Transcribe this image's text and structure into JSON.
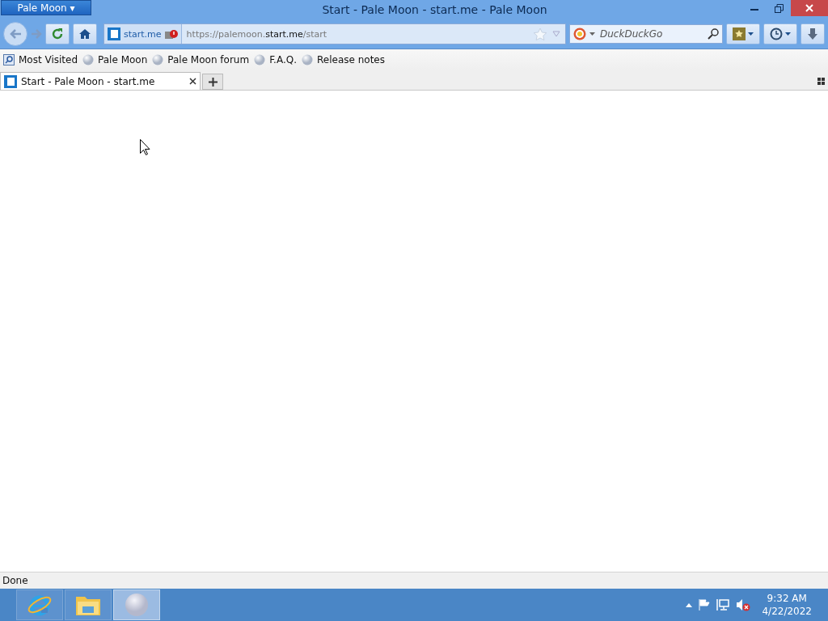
{
  "window": {
    "title": "Start - Pale Moon - start.me - Pale Moon",
    "app_menu": "Pale Moon ▾"
  },
  "toolbar": {
    "identity": "start.me",
    "url": "https://palemoon.**start.me**/start",
    "search_placeholder": "DuckDuckGo"
  },
  "bookmarks": [
    {
      "label": "Most Visited",
      "kind": "folder"
    },
    {
      "label": "Pale Moon",
      "kind": "page"
    },
    {
      "label": "Pale Moon forum",
      "kind": "page"
    },
    {
      "label": "F.A.Q.",
      "kind": "page"
    },
    {
      "label": "Release notes",
      "kind": "page"
    }
  ],
  "tabs": [
    {
      "label": "Start - Pale Moon - start.me",
      "selected": true
    }
  ],
  "status_bar": "Done",
  "taskbar": {
    "items": [
      {
        "kind": "ie",
        "selected": false
      },
      {
        "kind": "explorer",
        "selected": false
      },
      {
        "kind": "palemoon",
        "selected": true
      }
    ],
    "time": "9:32 AM",
    "date": "4/22/2022"
  }
}
